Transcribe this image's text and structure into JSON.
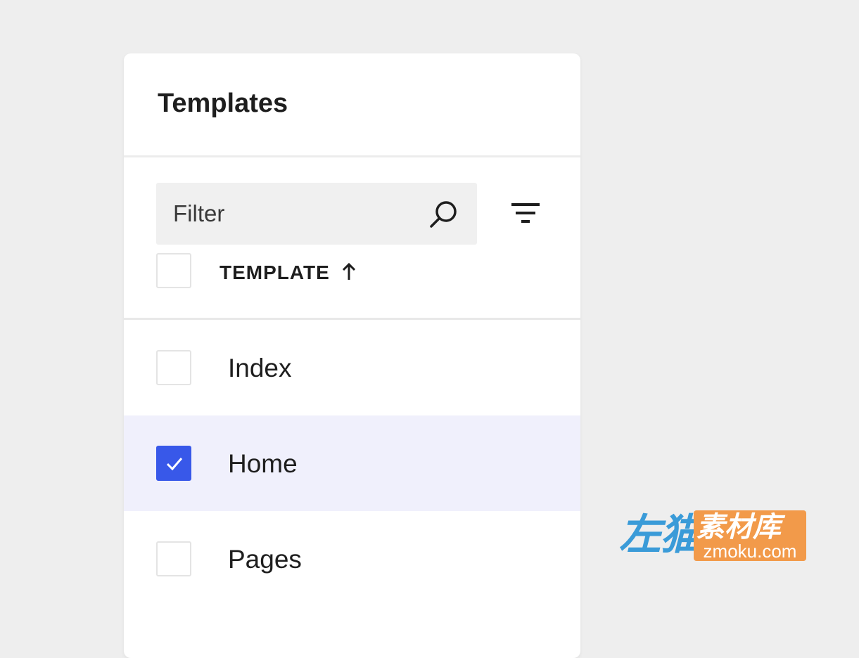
{
  "panel": {
    "title": "Templates"
  },
  "filter": {
    "placeholder": "Filter"
  },
  "table": {
    "column_header": "TEMPLATE",
    "sort_direction": "ascending",
    "rows": [
      {
        "label": "Index",
        "checked": false
      },
      {
        "label": "Home",
        "checked": true
      },
      {
        "label": "Pages",
        "checked": false
      }
    ]
  },
  "icons": {
    "search": "search-icon",
    "filter": "filter-lines-icon",
    "sort": "arrow-up-icon",
    "check": "check-icon"
  },
  "colors": {
    "accent": "#3858e9",
    "selected_row": "#f0f0fc",
    "background": "#eeeeee"
  },
  "watermark": {
    "brand": "左猫",
    "tagline": "素材库",
    "domain": "zmoku.com"
  }
}
